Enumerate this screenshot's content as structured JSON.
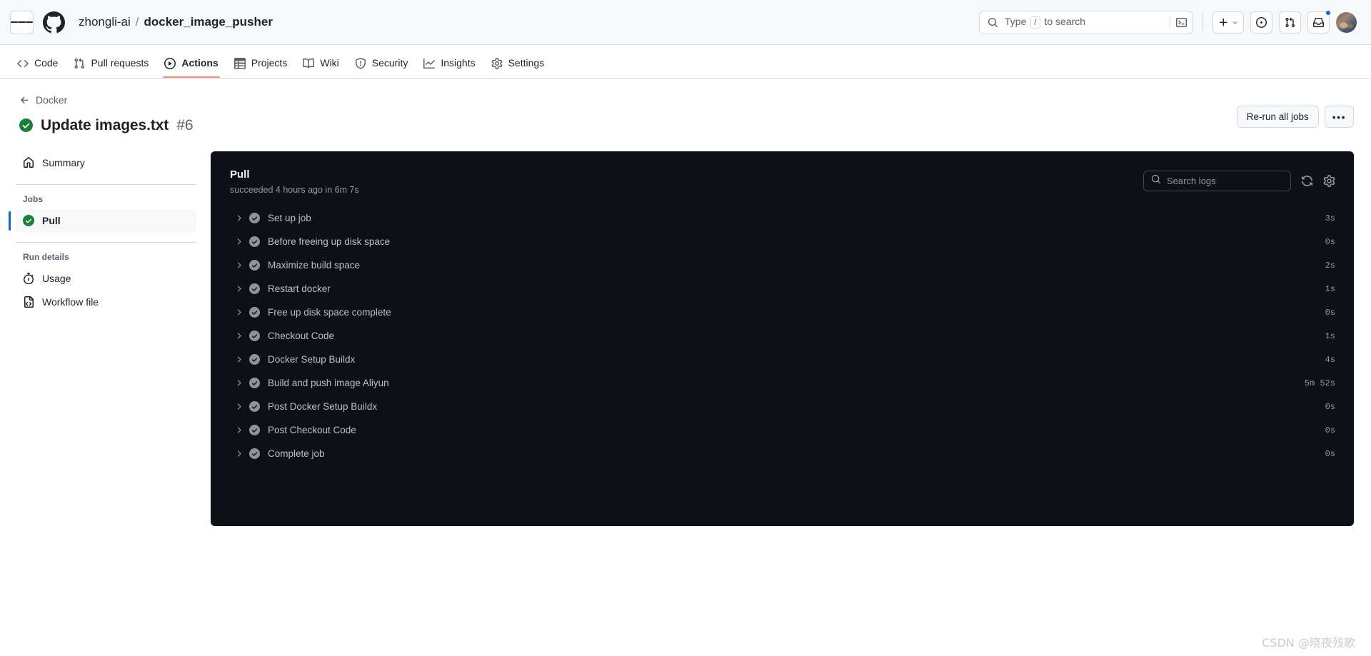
{
  "header": {
    "menu_icon": "hamburger-icon",
    "logo_icon": "github-logo-icon",
    "owner": "zhongli-ai",
    "separator": "/",
    "repo": "docker_image_pusher",
    "search": {
      "icon": "search-icon",
      "placeholder_before": "Type",
      "placeholder_key": "/",
      "placeholder_after": "to search",
      "command_icon": "terminal-icon"
    },
    "create_new_label": "+",
    "create_new_icon": "plus-icon",
    "create_new_caret": "chevron-down-icon",
    "issues_icon": "issue-opened-icon",
    "pull_requests_icon": "git-pull-request-icon",
    "notifications_icon": "inbox-icon",
    "notifications_has_unread": true,
    "avatar_icon": "user-avatar"
  },
  "repo_nav": {
    "tabs": [
      {
        "label": "Code",
        "icon": "code-icon",
        "active": false
      },
      {
        "label": "Pull requests",
        "icon": "git-pull-request-icon",
        "active": false
      },
      {
        "label": "Actions",
        "icon": "play-circle-icon",
        "active": true
      },
      {
        "label": "Projects",
        "icon": "table-icon",
        "active": false
      },
      {
        "label": "Wiki",
        "icon": "book-icon",
        "active": false
      },
      {
        "label": "Security",
        "icon": "shield-icon",
        "active": false
      },
      {
        "label": "Insights",
        "icon": "graph-icon",
        "active": false
      },
      {
        "label": "Settings",
        "icon": "gear-icon",
        "active": false
      }
    ]
  },
  "run": {
    "back_label": "Docker",
    "back_icon": "arrow-left-icon",
    "status_icon": "success-check-icon",
    "title": "Update images.txt",
    "number": "#6",
    "rerun_label": "Re-run all jobs",
    "kebab_label": "•••"
  },
  "sidebar": {
    "summary": {
      "label": "Summary",
      "icon": "home-icon"
    },
    "jobs_label": "Jobs",
    "jobs": [
      {
        "label": "Pull",
        "icon": "success-check-icon",
        "selected": true
      }
    ],
    "run_details_label": "Run details",
    "details": [
      {
        "label": "Usage",
        "icon": "stopwatch-icon"
      },
      {
        "label": "Workflow file",
        "icon": "workflow-file-icon"
      }
    ]
  },
  "log_panel": {
    "job_name": "Pull",
    "job_status": "succeeded 4 hours ago in 6m 7s",
    "search_placeholder": "Search logs",
    "search_icon": "search-icon",
    "refresh_icon": "sync-icon",
    "settings_icon": "gear-icon",
    "steps": [
      {
        "name": "Set up job",
        "duration": "3s",
        "status": "success",
        "expand_icon": "chevron-right-icon"
      },
      {
        "name": "Before freeing up disk space",
        "duration": "0s",
        "status": "success",
        "expand_icon": "chevron-right-icon"
      },
      {
        "name": "Maximize build space",
        "duration": "2s",
        "status": "success",
        "expand_icon": "chevron-right-icon"
      },
      {
        "name": "Restart docker",
        "duration": "1s",
        "status": "success",
        "expand_icon": "chevron-right-icon"
      },
      {
        "name": "Free up disk space complete",
        "duration": "0s",
        "status": "success",
        "expand_icon": "chevron-right-icon"
      },
      {
        "name": "Checkout Code",
        "duration": "1s",
        "status": "success",
        "expand_icon": "chevron-right-icon"
      },
      {
        "name": "Docker Setup Buildx",
        "duration": "4s",
        "status": "success",
        "expand_icon": "chevron-right-icon"
      },
      {
        "name": "Build and push image Aliyun",
        "duration": "5m 52s",
        "status": "success",
        "expand_icon": "chevron-right-icon"
      },
      {
        "name": "Post Docker Setup Buildx",
        "duration": "0s",
        "status": "success",
        "expand_icon": "chevron-right-icon"
      },
      {
        "name": "Post Checkout Code",
        "duration": "0s",
        "status": "success",
        "expand_icon": "chevron-right-icon"
      },
      {
        "name": "Complete job",
        "duration": "0s",
        "status": "success",
        "expand_icon": "chevron-right-icon"
      }
    ]
  },
  "watermark": "CSDN @晓夜残歌",
  "colors": {
    "accent": "#0969da",
    "success": "#1a7f37",
    "active_tab_underline": "#fd8c73",
    "panel_background": "#0d1117",
    "page_background": "#ffffff"
  }
}
